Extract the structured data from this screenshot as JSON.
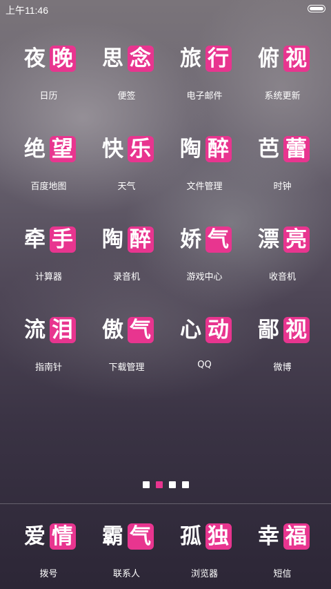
{
  "status_bar": {
    "time": "上午11:46",
    "battery_level": 1.0
  },
  "apps": [
    {
      "glyph1": "夜",
      "glyph2": "晚",
      "label": "日历"
    },
    {
      "glyph1": "思",
      "glyph2": "念",
      "label": "便签"
    },
    {
      "glyph1": "旅",
      "glyph2": "行",
      "label": "电子邮件"
    },
    {
      "glyph1": "俯",
      "glyph2": "视",
      "label": "系统更新"
    },
    {
      "glyph1": "绝",
      "glyph2": "望",
      "label": "百度地图"
    },
    {
      "glyph1": "快",
      "glyph2": "乐",
      "label": "天气"
    },
    {
      "glyph1": "陶",
      "glyph2": "醉",
      "label": "文件管理"
    },
    {
      "glyph1": "芭",
      "glyph2": "蕾",
      "label": "时钟"
    },
    {
      "glyph1": "牵",
      "glyph2": "手",
      "label": "计算器"
    },
    {
      "glyph1": "陶",
      "glyph2": "醉",
      "label": "录音机"
    },
    {
      "glyph1": "娇",
      "glyph2": "气",
      "label": "游戏中心"
    },
    {
      "glyph1": "漂",
      "glyph2": "亮",
      "label": "收音机"
    },
    {
      "glyph1": "流",
      "glyph2": "泪",
      "label": "指南针"
    },
    {
      "glyph1": "傲",
      "glyph2": "气",
      "label": "下载管理"
    },
    {
      "glyph1": "心",
      "glyph2": "动",
      "label": "QQ"
    },
    {
      "glyph1": "鄙",
      "glyph2": "视",
      "label": "微博"
    }
  ],
  "page_indicator": {
    "total": 4,
    "active_index": 1
  },
  "dock": [
    {
      "glyph1": "爱",
      "glyph2": "情",
      "label": "拨号"
    },
    {
      "glyph1": "霸",
      "glyph2": "气",
      "label": "联系人"
    },
    {
      "glyph1": "孤",
      "glyph2": "独",
      "label": "浏览器"
    },
    {
      "glyph1": "幸",
      "glyph2": "福",
      "label": "短信"
    }
  ],
  "colors": {
    "accent": "#e8358f",
    "text": "#ffffff"
  }
}
